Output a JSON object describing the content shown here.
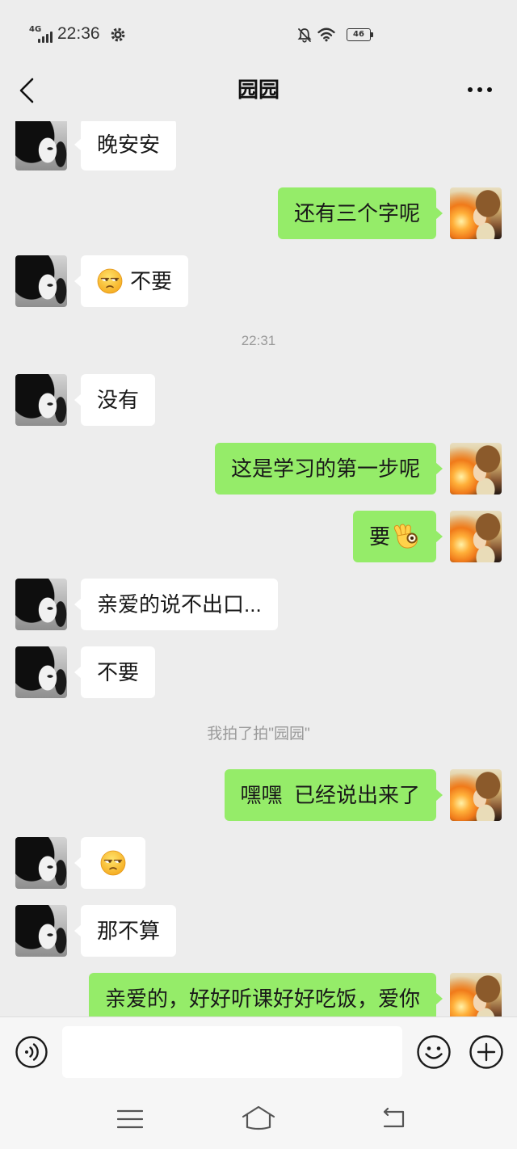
{
  "status_bar": {
    "network": "4G",
    "time": "22:36",
    "battery": "46",
    "icons": [
      "signal-icon",
      "gear-icon",
      "bell-off-icon",
      "wifi-icon",
      "battery-icon"
    ]
  },
  "header": {
    "title": "园园",
    "back_icon": "chevron-left-icon",
    "menu_icon": "more-icon"
  },
  "chat": [
    {
      "type": "message",
      "side": "left",
      "text": "晚安安"
    },
    {
      "type": "message",
      "side": "right",
      "text": "还有三个字呢"
    },
    {
      "type": "message",
      "side": "left",
      "emoji": "unamused-face",
      "text": "不要"
    },
    {
      "type": "time",
      "text": "22:31"
    },
    {
      "type": "message",
      "side": "left",
      "text": "没有"
    },
    {
      "type": "message",
      "side": "right",
      "text": "这是学习的第一步呢"
    },
    {
      "type": "message",
      "side": "right",
      "text": "要",
      "emoji_after": "ok-hand"
    },
    {
      "type": "message",
      "side": "left",
      "text": "亲爱的说不出口..."
    },
    {
      "type": "message",
      "side": "left",
      "text": "不要"
    },
    {
      "type": "system",
      "text": "我拍了拍\"园园\""
    },
    {
      "type": "message",
      "side": "right",
      "text": "嘿嘿  已经说出来了"
    },
    {
      "type": "message",
      "side": "left",
      "emoji": "unamused-face"
    },
    {
      "type": "message",
      "side": "left",
      "text": "那不算"
    },
    {
      "type": "message",
      "side": "right",
      "text": "亲爱的，好好听课好好吃饭，爱你"
    }
  ],
  "input_bar": {
    "icons": [
      "voice-icon",
      "emoji-icon",
      "plus-icon"
    ]
  },
  "nav_bar": {
    "icons": [
      "menu-icon",
      "home-icon",
      "back-icon"
    ]
  },
  "colors": {
    "chat_background": "#ededed",
    "self_bubble": "#95ec69",
    "other_bubble": "#ffffff",
    "meta_text": "#9a9a9a"
  }
}
